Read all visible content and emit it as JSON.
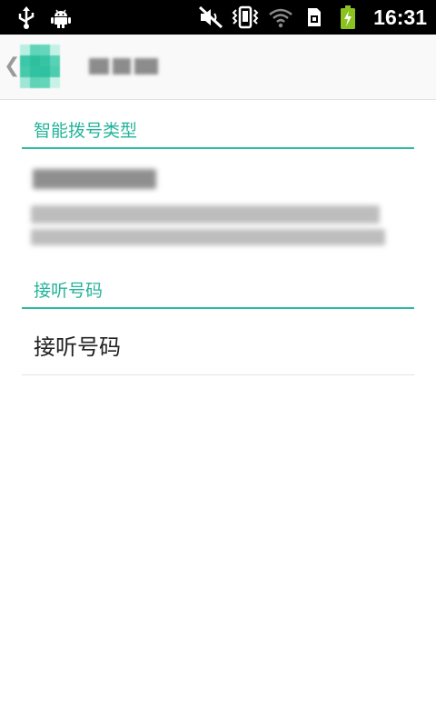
{
  "status_bar": {
    "time": "16:31",
    "icons": [
      "usb-icon",
      "android-debug-icon",
      "mute-icon",
      "vibrate-icon",
      "wifi-icon",
      "sim-card-icon",
      "battery-charging-icon"
    ]
  },
  "action_bar": {
    "title_blurred": true,
    "colors": {
      "icon_main": "#3cc7a8",
      "icon_light": "#8fe0cf"
    }
  },
  "sections": [
    {
      "header": "智能拨号类型",
      "item_blurred": true
    },
    {
      "header": "接听号码",
      "item_title": "接听号码"
    }
  ],
  "colors": {
    "accent": "#25b49a",
    "divider": "#2bbba0",
    "text_primary": "#222222",
    "status_bar": "#000000",
    "battery": "#8cc21f"
  }
}
